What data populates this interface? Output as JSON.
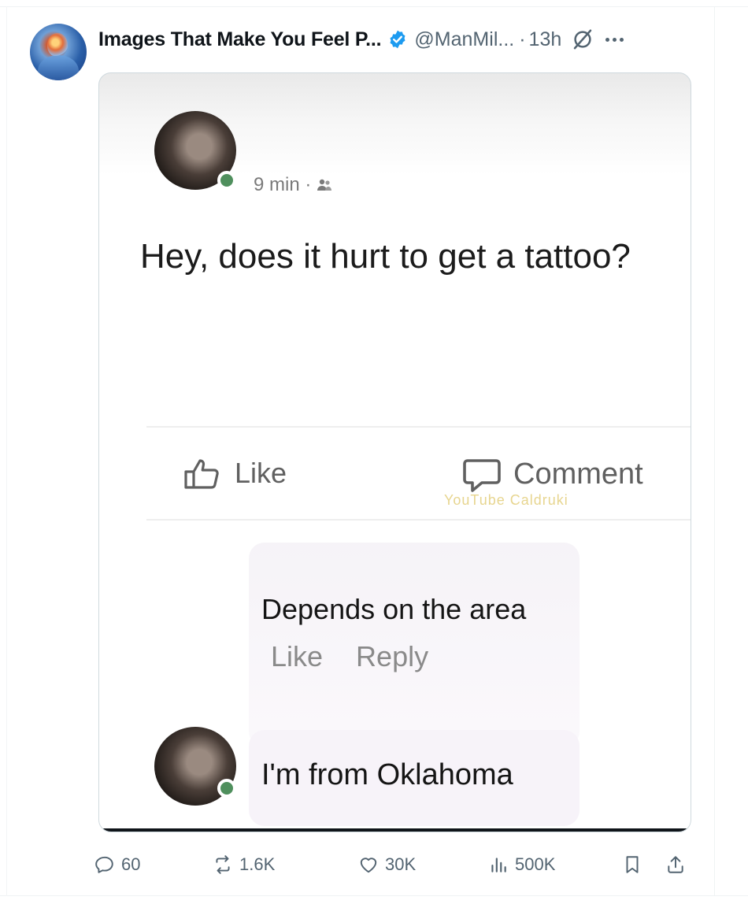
{
  "tweet": {
    "author_name": "Images That Make You Feel P...",
    "handle": "@ManMil...",
    "dot": "·",
    "time": "13h"
  },
  "image": {
    "post_time": "9 min ·",
    "post_text": "Hey, does it hurt to get a tattoo?",
    "like_label": "Like",
    "comment_label": "Comment",
    "watermark": "YouTube Caldruki",
    "reply_text": "Depends on the area",
    "reply_like": "Like",
    "reply_reply": "Reply",
    "reply2_text": "I'm from Oklahoma"
  },
  "actions": {
    "replies": "60",
    "reposts": "1.6K",
    "likes": "30K",
    "views": "500K"
  },
  "colors": {
    "verified": "#1d9bf0",
    "secondary_text": "#536471",
    "online": "#4f8f5d"
  }
}
